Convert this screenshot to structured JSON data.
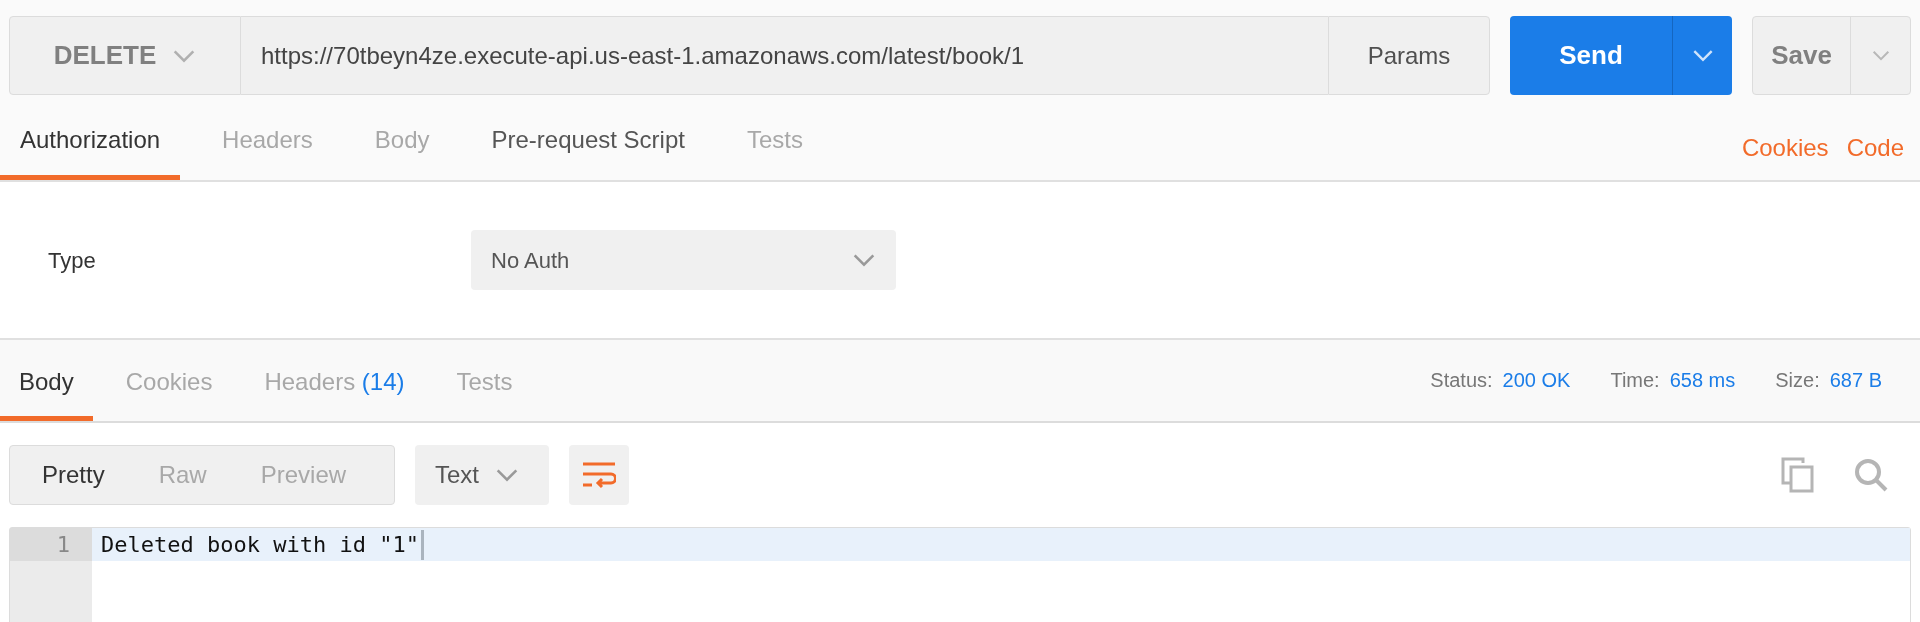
{
  "request": {
    "method": "DELETE",
    "url": "https://70tbeyn4ze.execute-api.us-east-1.amazonaws.com/latest/book/1",
    "params_label": "Params",
    "send_label": "Send",
    "save_label": "Save"
  },
  "request_tabs": [
    {
      "label": "Authorization",
      "selected": true
    },
    {
      "label": "Headers",
      "selected": false
    },
    {
      "label": "Body",
      "selected": false
    },
    {
      "label": "Pre-request Script",
      "selected": false,
      "emphasis": true
    },
    {
      "label": "Tests",
      "selected": false
    }
  ],
  "request_links": [
    "Cookies",
    "Code"
  ],
  "auth": {
    "label": "Type",
    "value": "No Auth"
  },
  "response_tabs": [
    {
      "label": "Body",
      "selected": true
    },
    {
      "label": "Cookies",
      "selected": false
    },
    {
      "label": "Headers",
      "count": "(14)",
      "selected": false
    },
    {
      "label": "Tests",
      "selected": false
    }
  ],
  "response_meta": [
    {
      "label": "Status:",
      "value": "200 OK"
    },
    {
      "label": "Time:",
      "value": "658 ms"
    },
    {
      "label": "Size:",
      "value": "687 B"
    }
  ],
  "view_modes": [
    {
      "label": "Pretty",
      "selected": true
    },
    {
      "label": "Raw",
      "selected": false
    },
    {
      "label": "Preview",
      "selected": false
    }
  ],
  "format": "Text",
  "wrap_lines": true,
  "code_lines": [
    {
      "number": "1",
      "text": "Deleted book with id \"1\"",
      "active": true
    }
  ]
}
